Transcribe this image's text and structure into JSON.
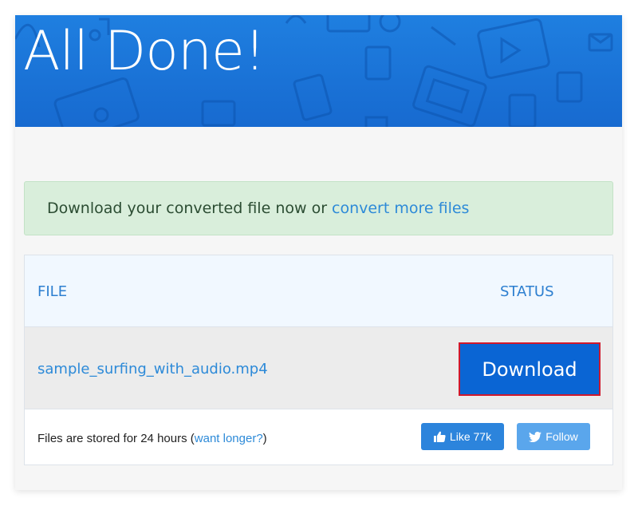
{
  "banner": {
    "title": "All Done!"
  },
  "alert": {
    "text": "Download your converted file now or",
    "link_text": "convert more files"
  },
  "table": {
    "columns": [
      "FILE",
      "STATUS"
    ],
    "rows": [
      {
        "file": "sample_surfing_with_audio.mp4",
        "status_button": "Download"
      }
    ]
  },
  "footer": {
    "stored_prefix": "Files are stored for 24 hours (",
    "stored_link": "want longer?",
    "stored_suffix": ")",
    "like_label": "Like 77k",
    "follow_label": "Follow"
  },
  "colors": {
    "banner": "#1a72d6",
    "alert_bg": "#d9eedb",
    "link": "#2d8ad8",
    "download_button": "#0a65d4",
    "download_button_border": "#d0182c"
  },
  "icons": {
    "like": "thumbs-up-icon",
    "follow": "twitter-bird-icon"
  }
}
